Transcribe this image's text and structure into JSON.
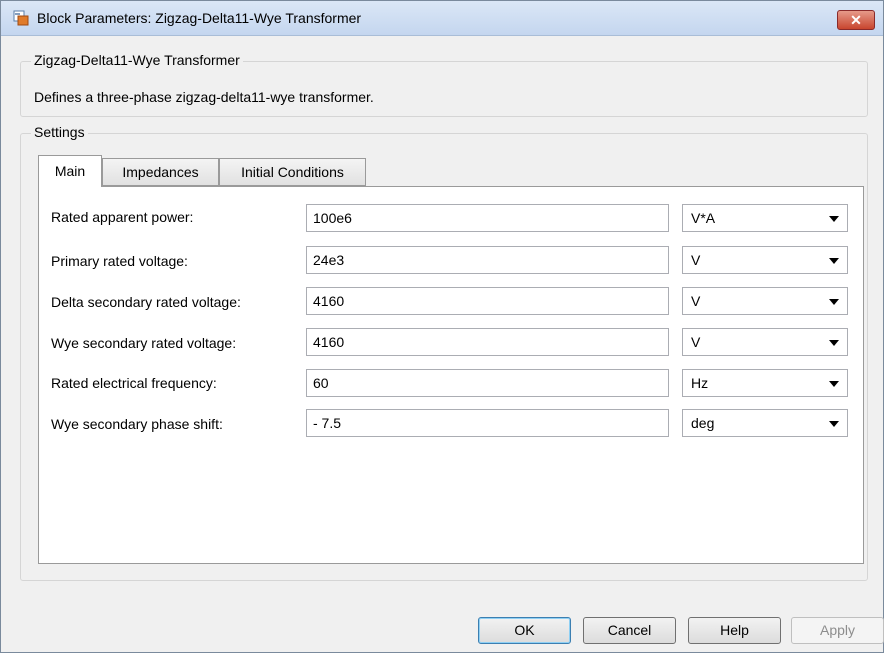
{
  "window": {
    "title": "Block Parameters: Zigzag-Delta11-Wye Transformer",
    "close_label": "✕"
  },
  "block": {
    "group_title": "Zigzag-Delta11-Wye Transformer",
    "description": "Defines a three-phase zigzag-delta11-wye transformer."
  },
  "settings": {
    "group_title": "Settings",
    "tabs": [
      {
        "label": "Main",
        "active": true
      },
      {
        "label": "Impedances",
        "active": false
      },
      {
        "label": "Initial Conditions",
        "active": false
      }
    ],
    "params": [
      {
        "label": "Rated apparent power:",
        "value": "100e6",
        "unit": "V*A"
      },
      {
        "label": "Primary rated voltage:",
        "value": "24e3",
        "unit": "V"
      },
      {
        "label": "Delta secondary rated voltage:",
        "value": "4160",
        "unit": "V"
      },
      {
        "label": "Wye secondary rated voltage:",
        "value": "4160",
        "unit": "V"
      },
      {
        "label": "Rated electrical frequency:",
        "value": "60",
        "unit": "Hz"
      },
      {
        "label": "Wye secondary phase shift:",
        "value": "- 7.5",
        "unit": "deg"
      }
    ]
  },
  "buttons": {
    "ok": "OK",
    "cancel": "Cancel",
    "help": "Help",
    "apply": "Apply"
  },
  "colors": {
    "titlebar": "#c4d6ef",
    "close": "#c8452e",
    "default_button_border": "#3c7fb1"
  }
}
